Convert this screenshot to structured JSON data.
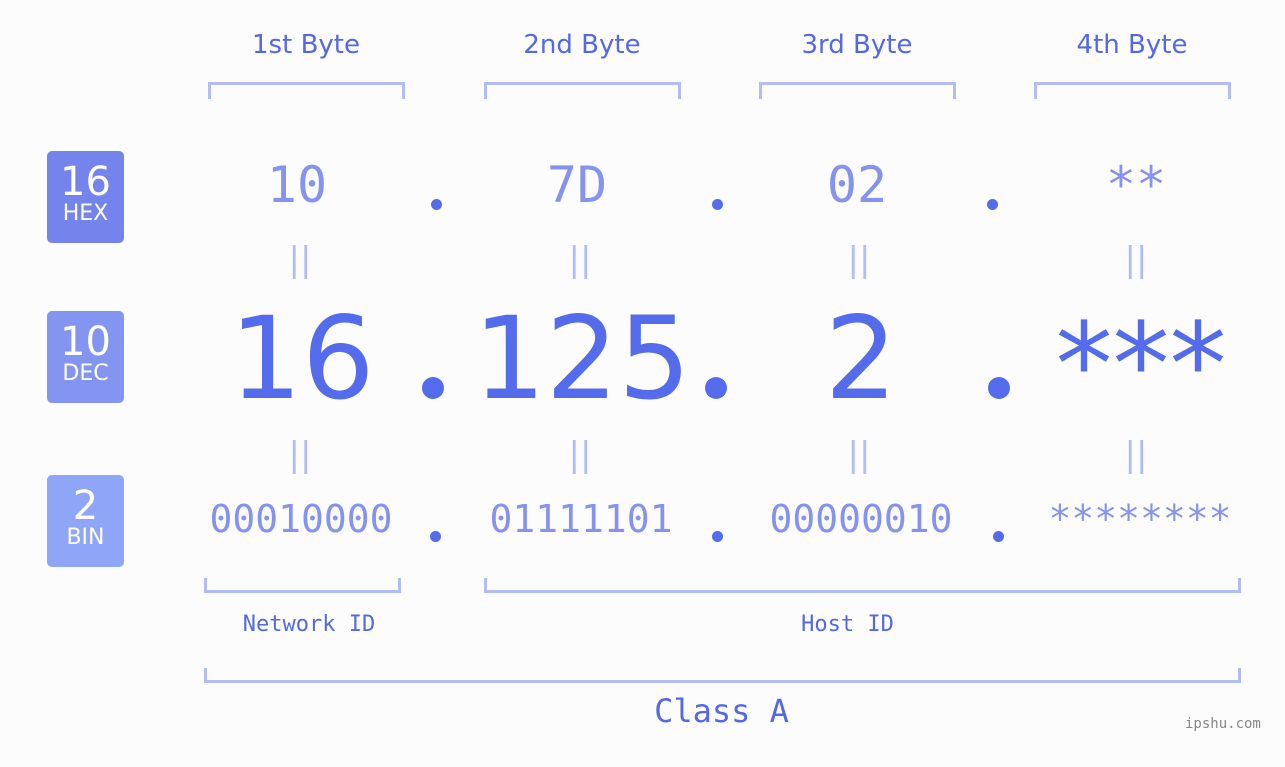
{
  "bytes": [
    {
      "label": "1st Byte",
      "hex": "10",
      "dec": "16",
      "bin": "00010000"
    },
    {
      "label": "2nd Byte",
      "hex": "7D",
      "dec": "125",
      "bin": "01111101"
    },
    {
      "label": "3rd Byte",
      "hex": "02",
      "dec": "2",
      "bin": "00000010"
    },
    {
      "label": "4th Byte",
      "hex": "**",
      "dec": "***",
      "bin": "********"
    }
  ],
  "badges": {
    "hex": {
      "num": "16",
      "name": "HEX",
      "color": "#7583ec"
    },
    "dec": {
      "num": "10",
      "name": "DEC",
      "color": "#8495f1"
    },
    "bin": {
      "num": "2",
      "name": "BIN",
      "color": "#8fa6f8"
    }
  },
  "equals_symbol": "||",
  "sections": {
    "network_id": "Network ID",
    "host_id": "Host ID",
    "class": "Class A"
  },
  "colors": {
    "accent": "#546cec",
    "light_accent": "#8593ee",
    "bracket": "#b4bcf6"
  },
  "watermark": "ipshu.com"
}
